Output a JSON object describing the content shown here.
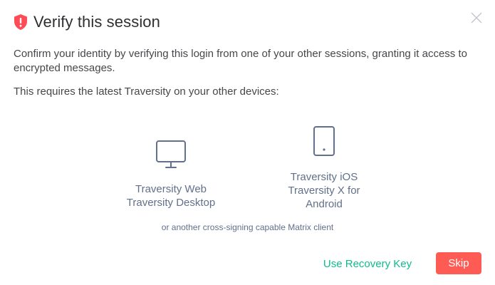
{
  "dialog": {
    "title": "Verify this session",
    "description": "Confirm your identity by verifying this login from one of your other sessions, granting it access to encrypted messages.",
    "requirement": "This requires the latest Traversity on your other devices:",
    "clients": [
      {
        "icon": "monitor-icon",
        "names": [
          "Traversity Web",
          "Traversity Desktop"
        ]
      },
      {
        "icon": "phone-icon",
        "names": [
          "Traversity iOS",
          "Traversity X for",
          "Android"
        ]
      }
    ],
    "other_clients": "or another cross-signing capable Matrix client",
    "recovery_key_label": "Use Recovery Key",
    "skip_label": "Skip"
  },
  "icons": {
    "header": "shield-alert-icon",
    "close": "close-icon"
  },
  "colors": {
    "accent": "#0dbd8b",
    "danger": "#ff5b55",
    "shield": "#ff4b55",
    "icon_stroke": "#61708b"
  }
}
